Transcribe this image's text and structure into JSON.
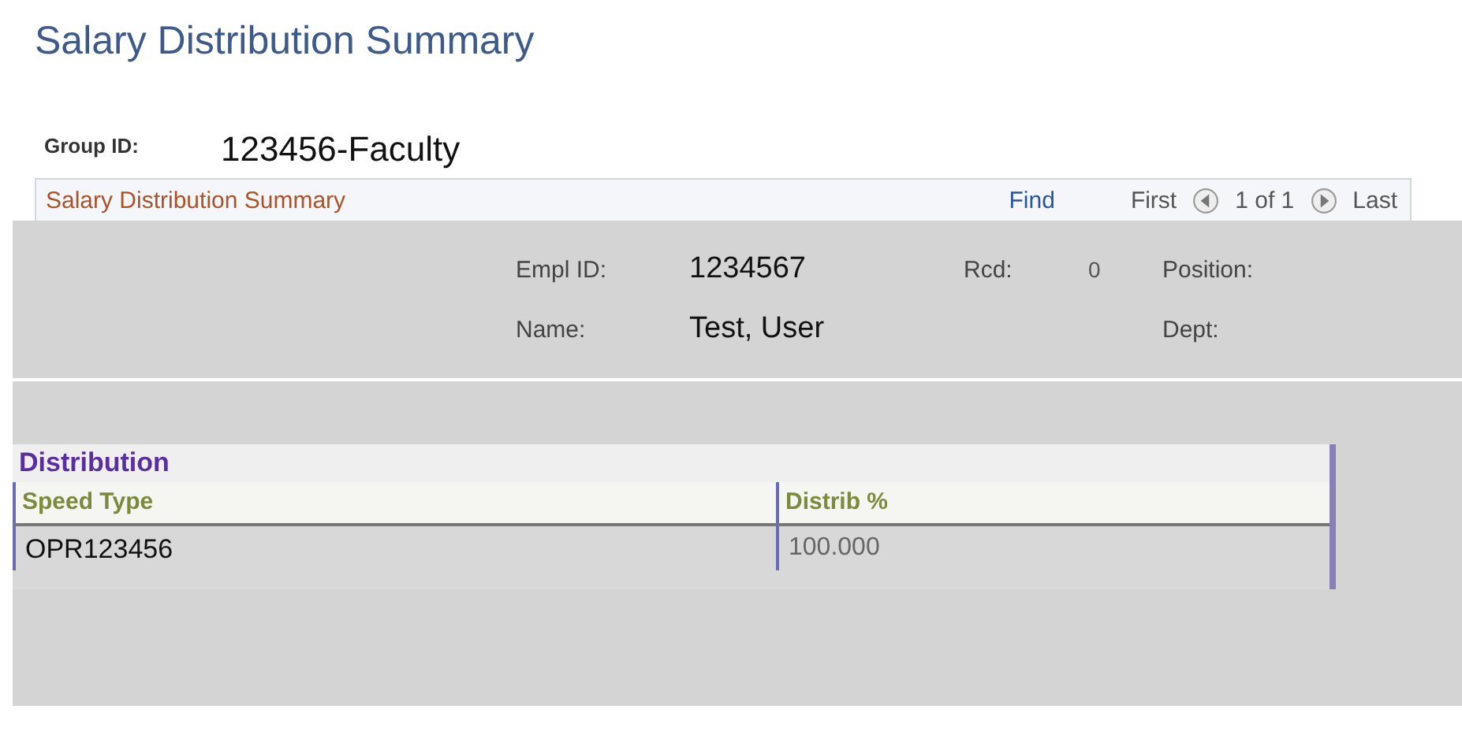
{
  "title": "Salary Distribution Summary",
  "group": {
    "label": "Group ID:",
    "value": "123456-Faculty"
  },
  "nav_bar": {
    "title": "Salary Distribution Summary",
    "find": "Find",
    "first": "First",
    "count": "1 of 1",
    "last": "Last"
  },
  "employee": {
    "fields": [
      {
        "label": "Empl ID:",
        "value": "1234567"
      },
      {
        "label": "Rcd:",
        "value": "0"
      },
      {
        "label": "Position:"
      },
      {
        "label": "Name:",
        "value": "Test, User"
      },
      {
        "label": "Dept:"
      }
    ]
  },
  "grid": {
    "title": "Distribution",
    "columns": [
      "Speed Type",
      "Distrib %"
    ],
    "rows": [
      [
        "OPR123456",
        "100.000"
      ]
    ]
  }
}
